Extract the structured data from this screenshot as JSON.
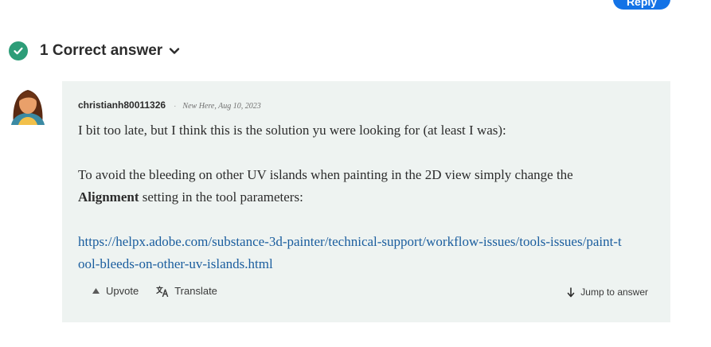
{
  "header": {
    "reply_label": "Reply",
    "correct_answer_label": "1 Correct answer"
  },
  "post": {
    "author": "christianh80011326",
    "separator": "·",
    "rank": "New Here",
    "date": "Aug 10, 2023",
    "paragraph1": "I bit too late, but I think this is the solution yu were looking for (at least I was):",
    "paragraph2_before": "To avoid the bleeding on other UV islands when painting in the 2D view simply change the ",
    "paragraph2_bold": "Alignment",
    "paragraph2_after": " setting in the tool parameters:",
    "link": "https://helpx.adobe.com/substance-3d-painter/technical-support/workflow-issues/tools-issues/paint-tool-bleeds-on-other-uv-islands.html"
  },
  "actions": {
    "upvote": "Upvote",
    "translate": "Translate",
    "jump": "Jump to answer"
  },
  "colors": {
    "accent": "#1473e6",
    "success": "#2d9d78",
    "card_bg": "#eef3f1",
    "link": "#1a5d9e"
  },
  "icons": [
    "check-circle-icon",
    "chevron-down-icon",
    "avatar",
    "upvote-arrow-icon",
    "translate-icon",
    "arrow-down-icon"
  ]
}
